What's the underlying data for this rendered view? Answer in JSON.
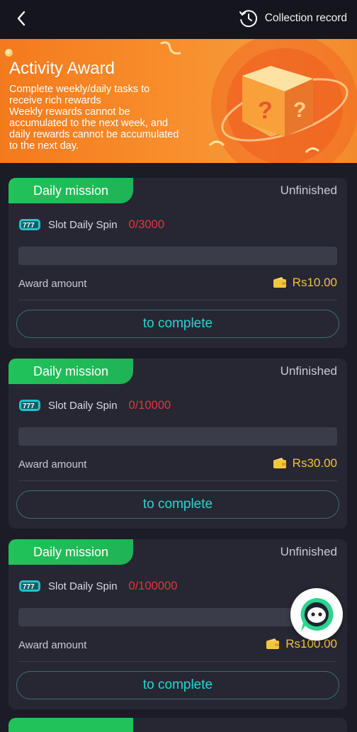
{
  "header": {
    "collection_record_label": "Collection record"
  },
  "banner": {
    "title": "Activity Award",
    "description_line1": "Complete weekly/daily tasks to",
    "description_line2": "receive rich rewards",
    "description_line3": "Weekly rewards cannot be",
    "description_line4": "accumulated to the next week, and",
    "description_line5": "daily rewards cannot be accumulated",
    "description_line6": "to the next day."
  },
  "missions": [
    {
      "tag": "Daily mission",
      "status": "Unfinished",
      "task_name": "Slot Daily Spin",
      "progress_text": "0/3000",
      "progress_fraction": 0,
      "award_label": "Award amount",
      "award_value": "Rs10.00",
      "button_label": "to complete"
    },
    {
      "tag": "Daily mission",
      "status": "Unfinished",
      "task_name": "Slot Daily Spin",
      "progress_text": "0/10000",
      "progress_fraction": 0,
      "award_label": "Award amount",
      "award_value": "Rs30.00",
      "button_label": "to complete"
    },
    {
      "tag": "Daily mission",
      "status": "Unfinished",
      "task_name": "Slot Daily Spin",
      "progress_text": "0/100000",
      "progress_fraction": 0,
      "award_label": "Award amount",
      "award_value": "Rs100.00",
      "button_label": "to complete"
    }
  ],
  "icons": {
    "back": "chevron-left-icon",
    "record": "history-clock-icon",
    "slot": "slot-777-icon",
    "wallet": "wallet-icon",
    "chat": "chat-bot-icon"
  },
  "colors": {
    "background": "#1b1c26",
    "card": "#262733",
    "mission_tag": "#21c25a",
    "progress_text": "#e0373c",
    "award_value": "#f2c23a",
    "button_text": "#27d6d0",
    "banner": "#f47a1e"
  }
}
